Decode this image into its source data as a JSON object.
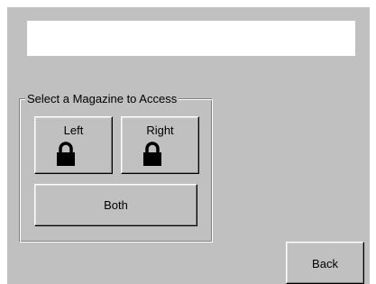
{
  "display": {
    "value": ""
  },
  "magazine_group": {
    "legend": "Select a Magazine to Access",
    "left_label": "Left",
    "left_icon": "lock-icon",
    "right_label": "Right",
    "right_icon": "lock-icon",
    "both_label": "Both"
  },
  "footer": {
    "back_label": "Back"
  },
  "colors": {
    "window_bg": "#c0c0c0",
    "display_bg": "#ffffff",
    "text": "#000000"
  }
}
